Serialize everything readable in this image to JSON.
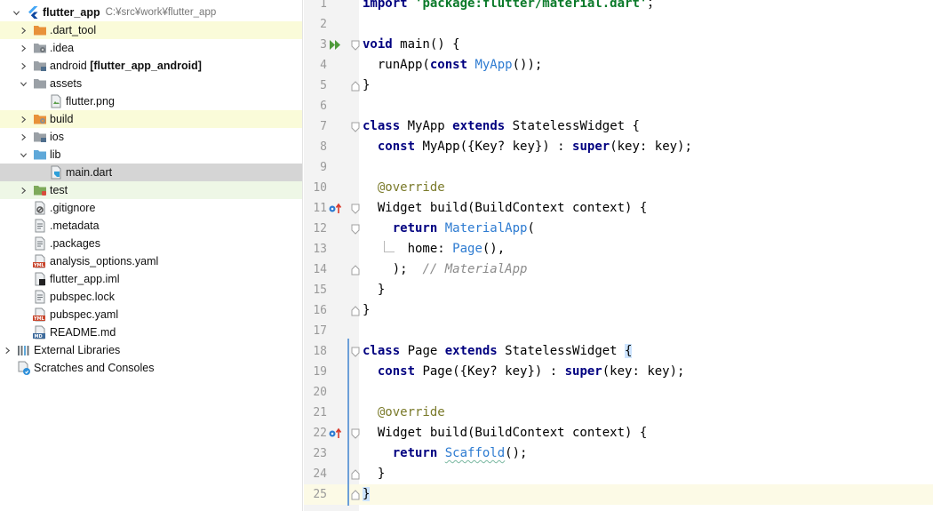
{
  "project": {
    "root": {
      "name": "flutter_app",
      "path": "C:¥src¥work¥flutter_app"
    },
    "items": [
      {
        "label": ".dart_tool",
        "indent": 1,
        "chevron": "right",
        "icon": "folder-orange-icon",
        "hl": "yellow"
      },
      {
        "label": ".idea",
        "indent": 1,
        "chevron": "right",
        "icon": "folder-config-icon",
        "hl": ""
      },
      {
        "label": "android",
        "extra": "[flutter_app_android]",
        "indent": 1,
        "chevron": "right",
        "icon": "folder-module-icon",
        "hl": ""
      },
      {
        "label": "assets",
        "indent": 1,
        "chevron": "down",
        "icon": "folder-gray-icon",
        "hl": ""
      },
      {
        "label": "flutter.png",
        "indent": 2,
        "chevron": "",
        "icon": "image-file-icon",
        "hl": ""
      },
      {
        "label": "build",
        "indent": 1,
        "chevron": "right",
        "icon": "folder-build-icon",
        "hl": "yellow"
      },
      {
        "label": "ios",
        "indent": 1,
        "chevron": "right",
        "icon": "folder-module-icon",
        "hl": ""
      },
      {
        "label": "lib",
        "indent": 1,
        "chevron": "down",
        "icon": "folder-blue-icon",
        "hl": ""
      },
      {
        "label": "main.dart",
        "indent": 2,
        "chevron": "",
        "icon": "dart-file-icon",
        "hl": "selected"
      },
      {
        "label": "test",
        "indent": 1,
        "chevron": "right",
        "icon": "folder-test-icon",
        "hl": "green"
      },
      {
        "label": ".gitignore",
        "indent": 1,
        "chevron": "",
        "icon": "gitignore-file-icon",
        "hl": ""
      },
      {
        "label": ".metadata",
        "indent": 1,
        "chevron": "",
        "icon": "text-file-icon",
        "hl": ""
      },
      {
        "label": ".packages",
        "indent": 1,
        "chevron": "",
        "icon": "text-file-icon",
        "hl": ""
      },
      {
        "label": "analysis_options.yaml",
        "indent": 1,
        "chevron": "",
        "icon": "yaml-file-icon",
        "hl": ""
      },
      {
        "label": "flutter_app.iml",
        "indent": 1,
        "chevron": "",
        "icon": "iml-file-icon",
        "hl": ""
      },
      {
        "label": "pubspec.lock",
        "indent": 1,
        "chevron": "",
        "icon": "text-file-icon",
        "hl": ""
      },
      {
        "label": "pubspec.yaml",
        "indent": 1,
        "chevron": "",
        "icon": "yaml-file-icon",
        "hl": ""
      },
      {
        "label": "README.md",
        "indent": 1,
        "chevron": "",
        "icon": "markdown-file-icon",
        "hl": ""
      },
      {
        "label": "External Libraries",
        "indent": 0,
        "chevron": "right",
        "icon": "library-icon",
        "hl": ""
      },
      {
        "label": "Scratches and Consoles",
        "indent": 0,
        "chevron": "",
        "icon": "scratches-icon",
        "hl": ""
      }
    ]
  },
  "editor": {
    "caret_line": 25,
    "lines": [
      {
        "n": "1",
        "tokens": [
          [
            "kw",
            "import "
          ],
          [
            "str",
            "'package:flutter/material.dart'"
          ],
          [
            "",
            "；"
          ]
        ]
      },
      {
        "n": "2",
        "tokens": []
      },
      {
        "n": "3",
        "gicon": "run",
        "tokens": [
          [
            "kw",
            "void"
          ],
          [
            "",
            " main() {"
          ]
        ]
      },
      {
        "n": "4",
        "tokens": [
          [
            "",
            "  runApp("
          ],
          [
            "kw",
            "const"
          ],
          [
            "",
            " "
          ],
          [
            "cls",
            "MyApp"
          ],
          [
            "",
            "());"
          ]
        ]
      },
      {
        "n": "5",
        "tokens": [
          [
            "",
            "}"
          ]
        ]
      },
      {
        "n": "6",
        "tokens": []
      },
      {
        "n": "7",
        "tokens": [
          [
            "kw",
            "class"
          ],
          [
            "",
            " MyApp "
          ],
          [
            "kw",
            "extends"
          ],
          [
            "",
            " StatelessWidget {"
          ]
        ]
      },
      {
        "n": "8",
        "tokens": [
          [
            "",
            "  "
          ],
          [
            "kw",
            "const"
          ],
          [
            "",
            " MyApp({Key? key}) : "
          ],
          [
            "kw",
            "super"
          ],
          [
            "",
            "(key: key);"
          ]
        ]
      },
      {
        "n": "9",
        "tokens": []
      },
      {
        "n": "10",
        "tokens": [
          [
            "",
            "  "
          ],
          [
            "ann",
            "@override"
          ]
        ]
      },
      {
        "n": "11",
        "gicon": "override",
        "tokens": [
          [
            "",
            "  Widget build(BuildContext context) {"
          ]
        ]
      },
      {
        "n": "12",
        "tokens": [
          [
            "",
            "    "
          ],
          [
            "kw",
            "return"
          ],
          [
            "",
            " "
          ],
          [
            "cls",
            "MaterialApp"
          ],
          [
            "",
            "("
          ]
        ]
      },
      {
        "n": "13",
        "tokens": [
          [
            "",
            "      home: "
          ],
          [
            "cls",
            "Page"
          ],
          [
            "",
            "(),"
          ]
        ]
      },
      {
        "n": "14",
        "tokens": [
          [
            "",
            "    );  "
          ],
          [
            "cmt",
            "// MaterialApp"
          ]
        ]
      },
      {
        "n": "15",
        "tokens": [
          [
            "",
            "  }"
          ]
        ]
      },
      {
        "n": "16",
        "tokens": [
          [
            "",
            "}"
          ]
        ]
      },
      {
        "n": "17",
        "tokens": []
      },
      {
        "n": "18",
        "tokens": [
          [
            "kw",
            "class"
          ],
          [
            "",
            " Page "
          ],
          [
            "kw",
            "extends"
          ],
          [
            "",
            " StatelessWidget "
          ],
          [
            "brace",
            "{"
          ]
        ]
      },
      {
        "n": "19",
        "tokens": [
          [
            "",
            "  "
          ],
          [
            "kw",
            "const"
          ],
          [
            "",
            " Page({Key? key}) : "
          ],
          [
            "kw",
            "super"
          ],
          [
            "",
            "(key: key);"
          ]
        ]
      },
      {
        "n": "20",
        "tokens": []
      },
      {
        "n": "21",
        "tokens": [
          [
            "",
            "  "
          ],
          [
            "ann",
            "@override"
          ]
        ]
      },
      {
        "n": "22",
        "gicon": "override",
        "tokens": [
          [
            "",
            "  Widget build(BuildContext context) {"
          ]
        ]
      },
      {
        "n": "23",
        "tokens": [
          [
            "",
            "    "
          ],
          [
            "kw",
            "return"
          ],
          [
            "",
            " "
          ],
          [
            "clsw",
            "Scaffold"
          ],
          [
            "",
            "();"
          ]
        ]
      },
      {
        "n": "24",
        "tokens": [
          [
            "",
            "  }"
          ]
        ]
      },
      {
        "n": "25",
        "tokens": [
          [
            "brace",
            "}"
          ]
        ]
      }
    ]
  },
  "colors": {
    "keyword": "#000080",
    "class_ref": "#2d7bd1",
    "annotation": "#7a7a2a",
    "selection": "#d5d5d5",
    "caret_line": "#fcfae6"
  }
}
